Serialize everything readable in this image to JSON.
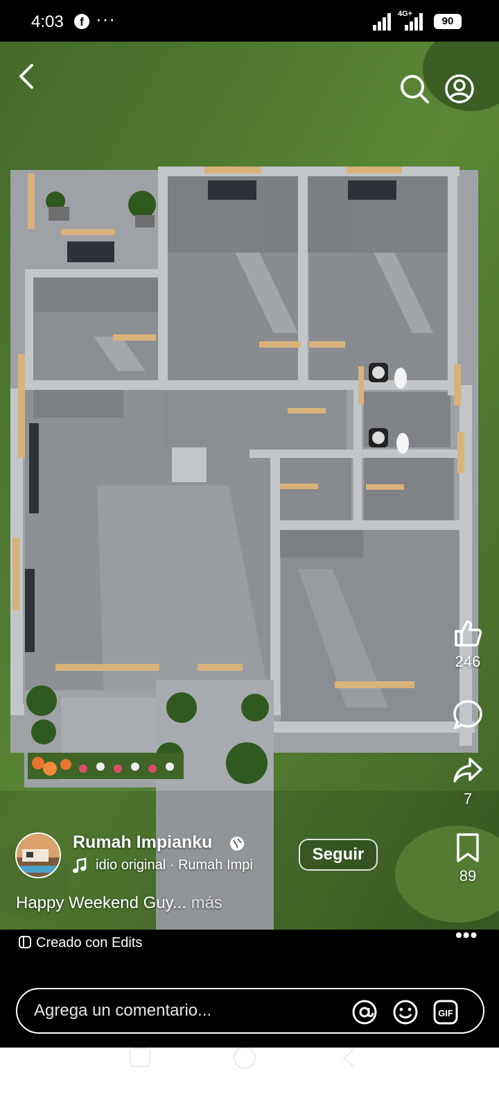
{
  "status_bar": {
    "time": "4:03",
    "more": "···",
    "network": "4G+",
    "battery": "90",
    "fb_icon": "facebook-icon"
  },
  "header": {
    "back_icon": "back-arrow-icon",
    "search_icon": "search-icon",
    "profile_icon": "profile-icon"
  },
  "actions": {
    "likes": "246",
    "shares": "7",
    "saves": "89",
    "icons": [
      "like-icon",
      "comment-icon",
      "share-icon",
      "bookmark-icon"
    ]
  },
  "post": {
    "author": "Rumah Impianku",
    "audio": "idio original · Rumah Impi",
    "follow_label": "Seguir",
    "caption": "Happy Weekend Guy...",
    "more_label": " más"
  },
  "footer": {
    "created_with": "Creado con Edits",
    "more": "•••",
    "comment_placeholder": "Agrega un comentario...",
    "comment_icons": [
      "mention-icon",
      "emoji-icon",
      "gif-icon"
    ]
  },
  "colors": {
    "grass": "#4f7a2e",
    "floor": "#8a8e93",
    "wall": "#b7babd",
    "wood": "#d9b27a"
  }
}
